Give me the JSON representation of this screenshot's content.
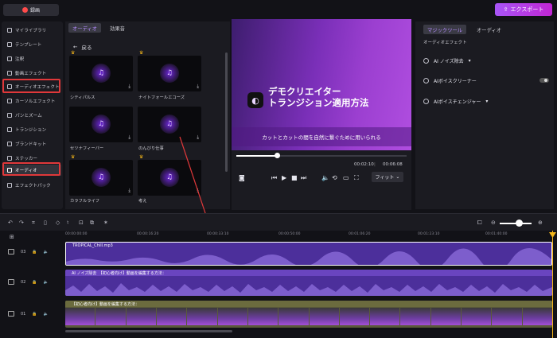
{
  "topbar": {
    "record_label": "録画",
    "export_label": "エクスポート"
  },
  "sidebar": {
    "items": [
      {
        "label": "マイライブラリ",
        "icon": "library-icon"
      },
      {
        "label": "テンプレート",
        "icon": "template-icon"
      },
      {
        "label": "注釈",
        "icon": "annotation-icon"
      },
      {
        "label": "動画エフェクト",
        "icon": "video-effect-icon"
      },
      {
        "label": "オーディオエフェクト",
        "icon": "audio-effect-icon"
      },
      {
        "label": "カーソルエフェクト",
        "icon": "cursor-effect-icon"
      },
      {
        "label": "パンとズーム",
        "icon": "pan-zoom-icon"
      },
      {
        "label": "トランジション",
        "icon": "transition-icon"
      },
      {
        "label": "ブランドキット",
        "icon": "brand-kit-icon"
      },
      {
        "label": "ステッカー",
        "icon": "sticker-icon"
      },
      {
        "label": "オーディオ",
        "icon": "audio-icon"
      },
      {
        "label": "エフェクトパック",
        "icon": "effect-pack-icon"
      }
    ]
  },
  "media": {
    "tabs": [
      "オーディオ",
      "効果音"
    ],
    "back_label": "戻る",
    "tracks": [
      {
        "label": "シティパルス",
        "premium": true
      },
      {
        "label": "ナイトフォールエコーズ",
        "premium": true
      },
      {
        "label": "セツナフィーバー",
        "premium": false
      },
      {
        "label": "のんびり仕事",
        "premium": false
      },
      {
        "label": "カラフルライフ",
        "premium": true
      },
      {
        "label": "考え",
        "premium": true
      }
    ]
  },
  "preview": {
    "title_line1": "デモクリエイター",
    "title_line2": "トランジション適用方法",
    "subtitle": "カットとカットの間を自然に繋ぐために用いられる",
    "current_time": "00:02:10",
    "separator": "|",
    "total_time": "00:06:08",
    "progress": 0.24,
    "fit_label": "フィット"
  },
  "right_panel": {
    "tabs": [
      "マジックツール",
      "オーディオ"
    ],
    "section_title": "オーディオエフェクト",
    "items": [
      "AI ノイズ除去",
      "AIボイスクリーナー",
      "AIボイスチェンジャー"
    ]
  },
  "timeline": {
    "ruler": [
      "00:00:00:00",
      "00:00:16:20",
      "00:00:33:10",
      "00:00:50:00",
      "00:01:06:20",
      "00:01:23:10",
      "00:01:40:00"
    ],
    "tracks": [
      {
        "index": "03",
        "clip_label": "TROPICAL_Chill.mp3"
      },
      {
        "index": "02",
        "clip_label": "AI ノイズ除去　【初心者向け】動画を編集する方法："
      },
      {
        "index": "01",
        "clip_label": "【初心者向け】動画を編集する方法："
      }
    ]
  },
  "colors": {
    "accent": "#a855f7",
    "highlight": "#e0383a",
    "playhead": "#f5b71a"
  }
}
